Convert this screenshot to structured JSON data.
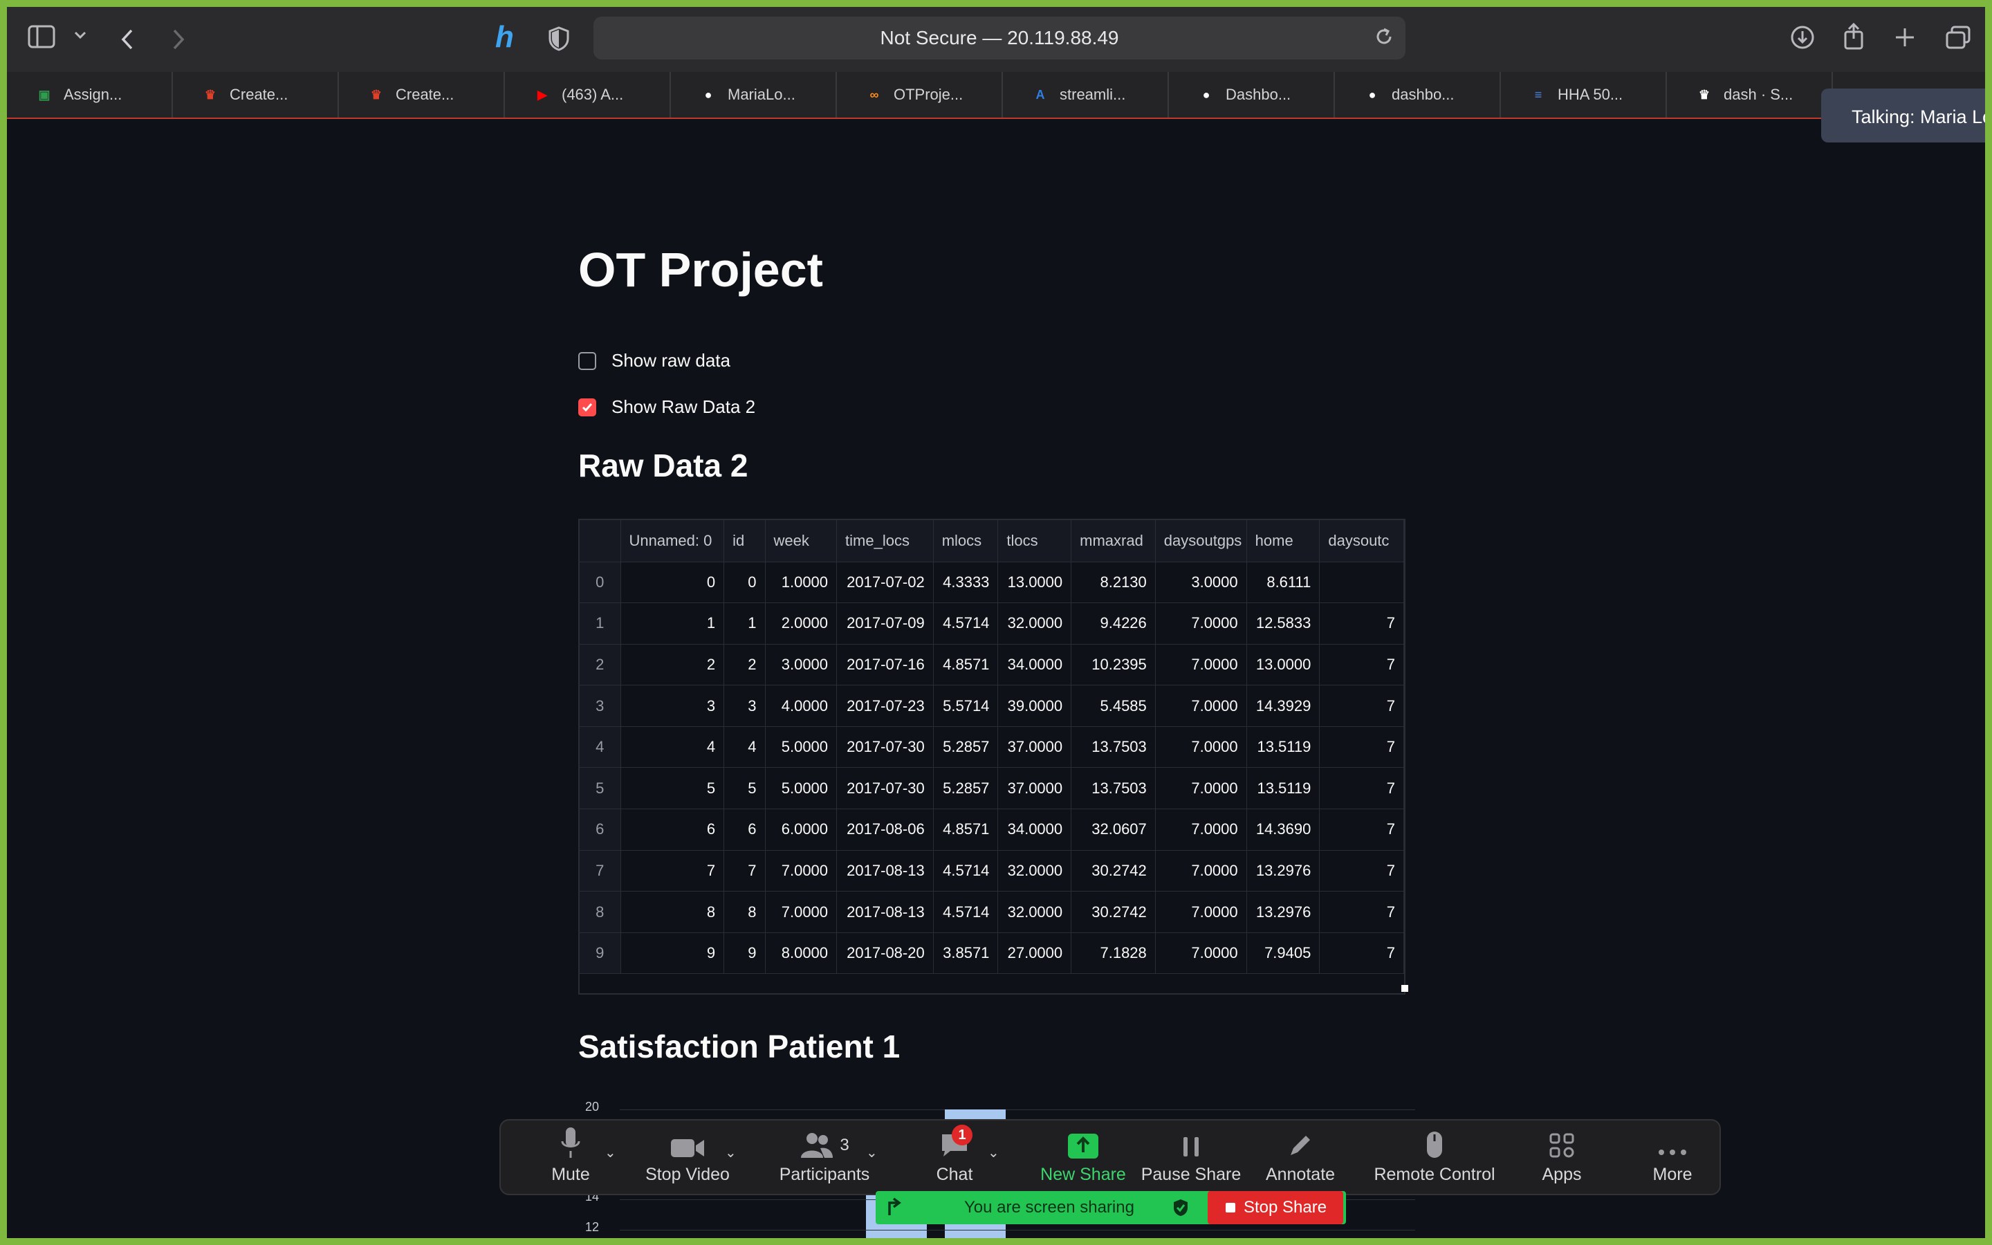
{
  "browser": {
    "address": "Not Secure — 20.119.88.49",
    "tabs": [
      {
        "label": "Assign...",
        "fav_color": "#2e9b4f",
        "fav_glyph": "▣"
      },
      {
        "label": "Create...",
        "fav_color": "#e0402a",
        "fav_glyph": "♛"
      },
      {
        "label": "Create...",
        "fav_color": "#e0402a",
        "fav_glyph": "♛"
      },
      {
        "label": "(463) A...",
        "fav_color": "#ff0000",
        "fav_glyph": "▶"
      },
      {
        "label": "MariaLo...",
        "fav_color": "#ffffff",
        "fav_glyph": "●"
      },
      {
        "label": "OTProje...",
        "fav_color": "#ff8c1a",
        "fav_glyph": "∞"
      },
      {
        "label": "streamli...",
        "fav_color": "#2f7fe0",
        "fav_glyph": "A"
      },
      {
        "label": "Dashbo...",
        "fav_color": "#ffffff",
        "fav_glyph": "●"
      },
      {
        "label": "dashbo...",
        "fav_color": "#ffffff",
        "fav_glyph": "●"
      },
      {
        "label": "HHA 50...",
        "fav_color": "#4a86e8",
        "fav_glyph": "≡"
      },
      {
        "label": "dash · S...",
        "fav_color": "#ffffff",
        "fav_glyph": "♛"
      }
    ]
  },
  "zoom_tooltip": "Talking: Maria Lo",
  "app": {
    "title": "OT Project",
    "checkbox_raw": "Show raw data",
    "checkbox_raw2": "Show Raw Data 2",
    "section_raw2": "Raw Data 2",
    "section_satisfaction": "Satisfaction Patient 1"
  },
  "table": {
    "columns": [
      "",
      "Unnamed: 0",
      "id",
      "week",
      "time_locs",
      "mlocs",
      "tlocs",
      "mmaxrad",
      "daysoutgps",
      "home",
      "daysoutc"
    ],
    "rows": [
      [
        "0",
        "0",
        "0",
        "1.0000",
        "2017-07-02",
        "4.3333",
        "13.0000",
        "8.2130",
        "3.0000",
        "8.6111",
        ""
      ],
      [
        "1",
        "1",
        "1",
        "2.0000",
        "2017-07-09",
        "4.5714",
        "32.0000",
        "9.4226",
        "7.0000",
        "12.5833",
        "7"
      ],
      [
        "2",
        "2",
        "2",
        "3.0000",
        "2017-07-16",
        "4.8571",
        "34.0000",
        "10.2395",
        "7.0000",
        "13.0000",
        "7"
      ],
      [
        "3",
        "3",
        "3",
        "4.0000",
        "2017-07-23",
        "5.5714",
        "39.0000",
        "5.4585",
        "7.0000",
        "14.3929",
        "7"
      ],
      [
        "4",
        "4",
        "4",
        "5.0000",
        "2017-07-30",
        "5.2857",
        "37.0000",
        "13.7503",
        "7.0000",
        "13.5119",
        "7"
      ],
      [
        "5",
        "5",
        "5",
        "5.0000",
        "2017-07-30",
        "5.2857",
        "37.0000",
        "13.7503",
        "7.0000",
        "13.5119",
        "7"
      ],
      [
        "6",
        "6",
        "6",
        "6.0000",
        "2017-08-06",
        "4.8571",
        "34.0000",
        "32.0607",
        "7.0000",
        "14.3690",
        "7"
      ],
      [
        "7",
        "7",
        "7",
        "7.0000",
        "2017-08-13",
        "4.5714",
        "32.0000",
        "30.2742",
        "7.0000",
        "13.2976",
        "7"
      ],
      [
        "8",
        "8",
        "8",
        "7.0000",
        "2017-08-13",
        "4.5714",
        "32.0000",
        "30.2742",
        "7.0000",
        "13.2976",
        "7"
      ],
      [
        "9",
        "9",
        "9",
        "8.0000",
        "2017-08-20",
        "3.8571",
        "27.0000",
        "7.1828",
        "7.0000",
        "7.9405",
        "7"
      ]
    ]
  },
  "chart_ticks": [
    "20",
    "14",
    "12"
  ],
  "zoom": {
    "mute": "Mute",
    "stop_video": "Stop Video",
    "participants": "Participants",
    "participants_count": "3",
    "chat": "Chat",
    "chat_badge": "1",
    "new_share": "New Share",
    "pause_share": "Pause Share",
    "annotate": "Annotate",
    "remote_control": "Remote Control",
    "apps": "Apps",
    "more": "More",
    "sharing_text": "You are screen sharing",
    "stop_share": "Stop Share"
  }
}
